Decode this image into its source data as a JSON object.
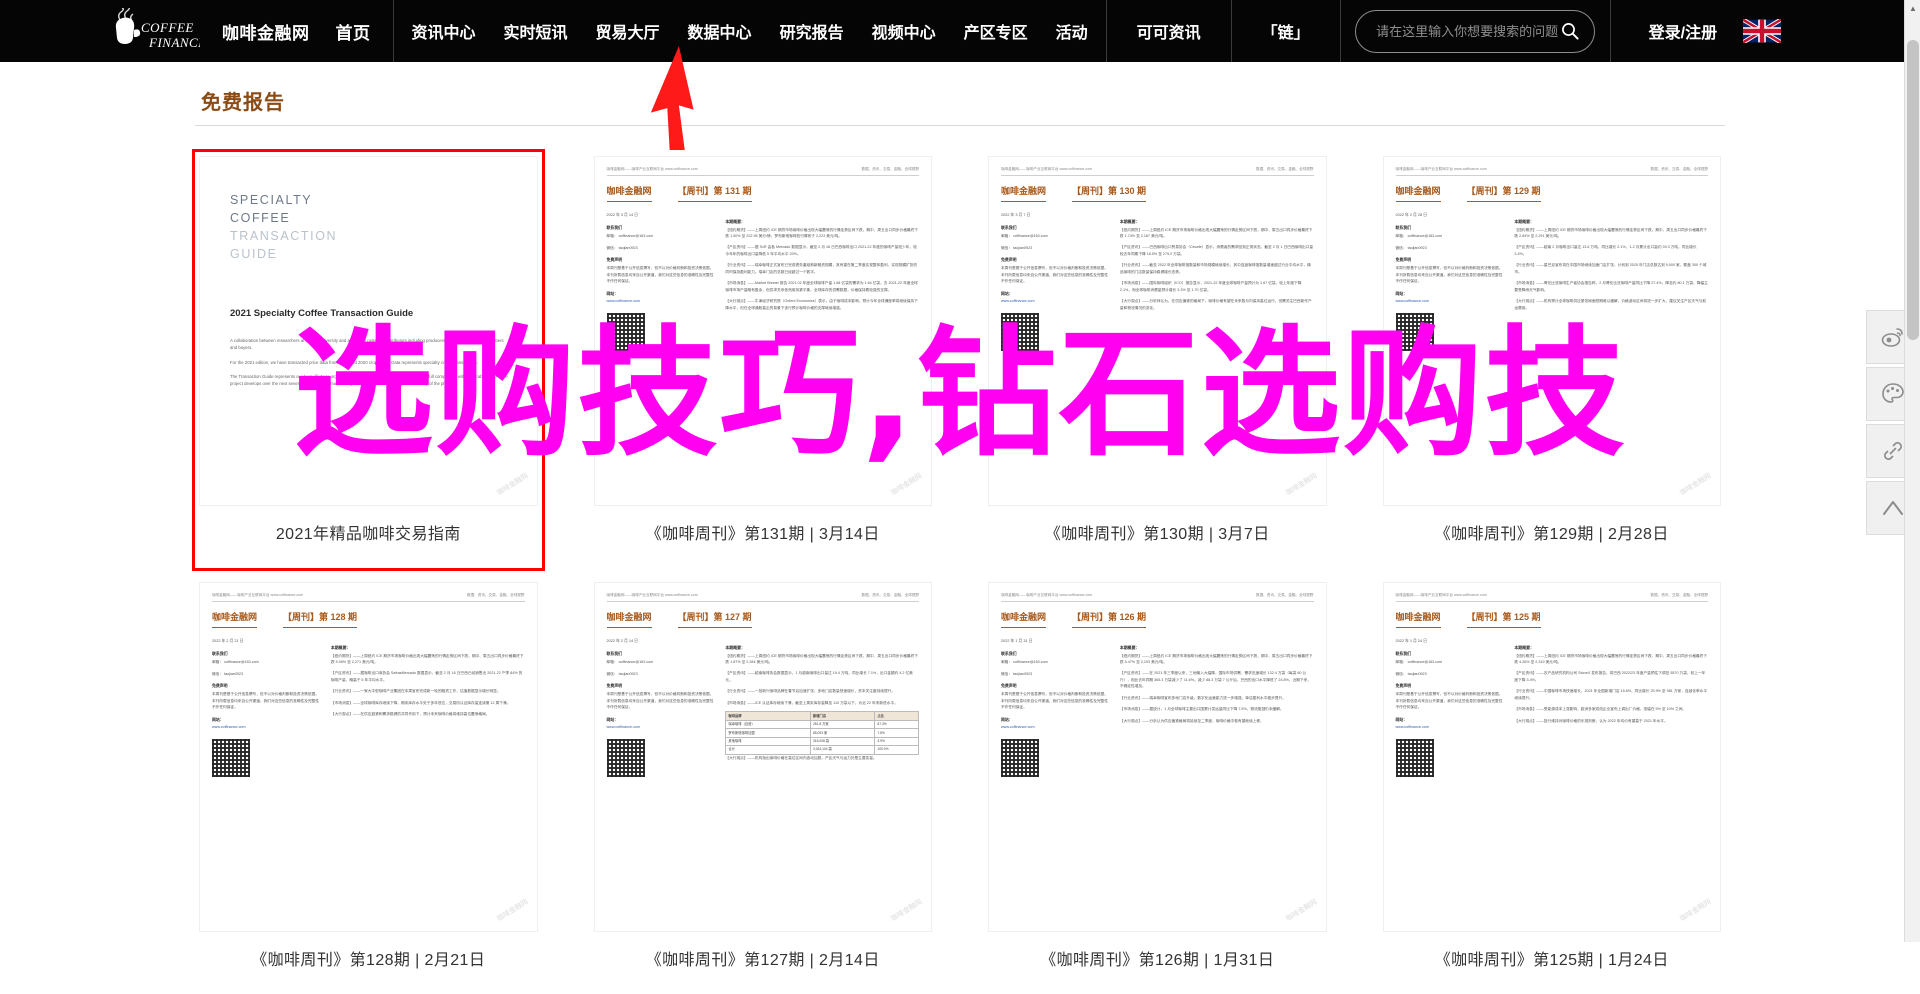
{
  "nav": {
    "logo_line1": "COFFEE",
    "logo_line2": "FINANCE",
    "brand": "咖啡金融网",
    "home": "首页",
    "main_items": [
      {
        "label": "资讯中心"
      },
      {
        "label": "实时短讯"
      },
      {
        "label": "贸易大厅"
      },
      {
        "label": "数据中心"
      },
      {
        "label": "研究报告"
      },
      {
        "label": "视频中心"
      },
      {
        "label": "产区专区"
      },
      {
        "label": "活动"
      }
    ],
    "cell_cocoa": "可可资讯",
    "cell_chain": "「链」",
    "search_placeholder": "请在这里输入你想要搜索的问题",
    "search_value": "",
    "search_icon": "search-icon",
    "login": "登录/注册",
    "flag": "uk-flag-icon"
  },
  "main": {
    "section_title": "免费报告",
    "title_color": "#8a4b14",
    "highlight_color": "#ff0000"
  },
  "cards": [
    {
      "type": "cover",
      "caption": "2021年精品咖啡交易指南",
      "highlighted": true,
      "cover": {
        "line1": "SPECIALTY",
        "line2": "COFFEE",
        "line3": "TRANSACTION",
        "line4": "GUIDE",
        "subtitle": "2021 Specialty Coffee Transaction Guide",
        "p1": "A collaboration between researchers at Emory University and a growing roster of contributors including producers, exporters, importers, roasters and buyers.",
        "p2": "For the 2021 edition, we have transacted price data from 2019 and 2020 crop years. Data represents specialty coffee transactions.",
        "p3": "The Transaction Guide represents our best efforts to organize and analyze the contract data provided in full compliance with applicable law. As the project develops over the next several years, we will make every effort to improve the utility and usability of the platform."
      },
      "watermark": "咖啡金融网"
    },
    {
      "type": "doc",
      "caption": "《咖啡周刊》第131期 | 3月14日",
      "highlighted": false,
      "doc": {
        "head_left": "咖啡金融网——咖啡产业互联网平台 www.coffinance.com",
        "head_right": "数据、资讯、交易、金融、全球视野",
        "brand": "咖啡金融网",
        "issue": "【周刊】第 131 期",
        "date": "2022 年 3 月 14 日",
        "contact_label": "联系我们",
        "contact_mail": "邮箱： coffinance@163.com",
        "contact_wx": "微信： taojian0923",
        "free_label": "免费声明",
        "free_text": "本周刊是基于公开信息撰写，但不以对价格判断和投资决策依据。本刊所载信息均来自公开渠道，我们对这些信息的准确性及完整性不作任何保证。",
        "right_label": "本期概要：",
        "p1": "【纽约期货】——上周纽约 ICE 期货市场咖啡价格出现大幅震荡的行情走势区间下跌，期中、周五出口同步价格最终下跌 1.50% 至 222.95 美分/磅，罗布斯塔咖啡较行情收于 2,223 美元/吨。",
        "p2": "【产区资讯】——据 SvR 由各 Mercado 数据显示，截至 2 月 18 日巴西咖啡出口 2021-22 年度的咖啡产量较少年，较今年年的咖啡出口量降低 5 年平均水平 20%。",
        "p3": "【行业资讯】——瑞幸咖啡正式宣布已完成债务重组和新融资规模，其有望在第二季度实现整体盈利，实现规模扩张的同时保持盈利能力。瑞幸门店的总数已经超过一个数字。",
        "p4": "【市场消息】——Market Brewer 报告 2021 02 年度全球咖啡产量 1.68 亿袋的需求为 1.64 亿袋。去 2021-22 年度全球咖啡市场产量略有盈余，但供求关系依然维持紧平衡，全球库存的供需数据，价格保持着较强的支撑。",
        "p5": "【大行观点】——牛津经济研究院（Oxford Economics）表示，由于咖啡成本影响，预计今年全球通胀率将继续保持下降水平，但在全球通胀高企的背景下该行预计咖啡价格的支撑继续增强。",
        "link_label": "网站：",
        "link": "www.coffinance.com",
        "watermark": "咖啡金融网"
      }
    },
    {
      "type": "doc",
      "caption": "《咖啡周刊》第130期 | 3月7日",
      "highlighted": false,
      "doc": {
        "head_left": "咖啡金融网——咖啡产业互联网平台 www.coffinance.com",
        "head_right": "数据、资讯、交易、金融、全球视野",
        "brand": "咖啡金融网",
        "issue": "【周刊】第 130 期",
        "date": "2022 年 3 月 7 日",
        "contact_label": "联系我们",
        "contact_mail": "邮箱： coffinance@163.com",
        "contact_wx": "微信： taojian0923",
        "free_label": "免费声明",
        "free_text": "本周刊是基于公开信息撰写，但不以对价格判断和投资决策依据。本刊所载信息均来自公开渠道，我们对这些信息的准确性及完整性不作任何保证。",
        "right_label": "本期概要：",
        "p1": "【纽约期货】——上周纽约 ICE 期货市场咖啡价格出现大幅震荡的行情走势区间下跌，期中、周五出口同步价格最终下跌 1.74% 至 2,187 美元/吨。",
        "p2": "【产区资讯】——巴西咖啡出口贸易协会（Cecafe）显示，消费者的需求回到正常状态，截至 2 月 1 日巴西咖啡出口量较去年同期下降 18.5% 至 279.2 万袋。",
        "p3": "【行业资讯】——截至 2022 年全球咖啡馆数量和市场规模继续增长，其中连锁咖啡馆数量增速超过行业平均水平，精品咖啡的门店数量保持稳健增长态势。",
        "p4": "【市场消息】——国际咖啡组织（ICO）报告显示，2021-22 年度全球咖啡产量预计为 1.67 亿袋，较上年度下降 2.1%，而全球咖啡消费量预计增长 3.3% 至 1.70 亿袋。",
        "p5": "【大行观点】——分析师认为，在供应偏紧的格局下，咖啡价格有望在未来数月内保持高位运行，但需关注巴西新作产量和物流情况的变化。",
        "link_label": "网站：",
        "link": "www.coffinance.com",
        "watermark": "咖啡金融网"
      }
    },
    {
      "type": "doc",
      "caption": "《咖啡周刊》第129期 | 2月28日",
      "highlighted": false,
      "doc": {
        "head_left": "咖啡金融网——咖啡产业互联网平台 www.coffinance.com",
        "head_right": "数据、资讯、交易、金融、全球视野",
        "brand": "咖啡金融网",
        "issue": "【周刊】第 129 期",
        "date": "2022 年 2 月 28 日",
        "contact_label": "联系我们",
        "contact_mail": "邮箱： coffinance@163.com",
        "contact_wx": "微信： taojian0923",
        "free_label": "免费声明",
        "free_text": "本周刊是基于公开信息撰写，但不以对价格判断和投资决策依据。本刊所载信息均来自公开渠道，我们对这些信息的准确性及完整性不作任何保证。",
        "right_label": "本期概要：",
        "p1": "【纽约期货】——上周纽约 ICE 期货市场咖啡价格出现大幅震荡的行情走势区间下跌，期中、周五出口同步价格最终下跌 2.84% 至 2,291 美元/吨。",
        "p2": "【产区资讯】——越南 2 月咖啡出口量达 13.6 万吨，同比增长 2.1%，1-2 月累计出口量约 39.3 万吨，同比增长 3.4%。",
        "p3": "【行业资讯】——星巴克宣布将在中国市场继续加速门店扩张，计划到 2025 年门店总数达到 9,000 家，覆盖 300 个城市。",
        "p4": "【市场消息】——哥伦比亚咖啡生产者协会报告称，2 月哥伦比亚咖啡产量同比下降 27.4%，降至约 80.1 万袋，降幅主要受降雨天气影响。",
        "p5": "【大行观点】——机构预计全球咖啡供应紧张局面短期难以缓解，价格波动区间将进一步扩大，建议关注产区天气与航运费用。",
        "link_label": "网站：",
        "link": "www.coffinance.com",
        "watermark": "咖啡金融网"
      }
    },
    {
      "type": "doc",
      "caption": "《咖啡周刊》第128期 | 2月21日",
      "highlighted": false,
      "doc": {
        "head_left": "咖啡金融网——咖啡产业互联网平台 www.coffinance.com",
        "head_right": "数据、资讯、交易、金融、全球视野",
        "brand": "咖啡金融网",
        "issue": "【周刊】第 128 期",
        "date": "2022 年 2 月 21 日",
        "contact_label": "联系我们",
        "contact_mail": "邮箱： coffinance@163.com",
        "contact_wx": "微信： taojian0923",
        "free_label": "免费声明",
        "free_text": "本周刊是基于公开信息撰写，但不以对价格判断和投资决策依据。本刊所载信息均来自公开渠道，我们对这些信息的准确性及完整性不作任何保证。",
        "right_label": "本期概要：",
        "p1": "【纽约期货】——上周纽约 ICE 期货市场咖啡价格出现大幅震荡的行情走势区间下跌，期中、周五出口同步价格最终下跌 5.05% 至 2,271 美元/吨。",
        "p2": "【产区资讯】——据咖啡出口商协会 SafrasMercado 数据显示，截至 2 月 16 日巴西已经销售出 2021-22 产季 84% 的咖啡产量，略高于 5 年平均水平。",
        "p3": "【行业资讯】——一家大中型咖啡产业集团在本周宣布完成新一轮的融资工作，估值数据显示增长明显。",
        "p4": "【市场消息】——全球咖啡库存继续下降，期末库存水平处于多年低位，交易所认证库存量连续第 12 周下滑。",
        "p5": "【大行观点】——在供应趋紧和需求稳健的共同作用下，预计未来咖啡价格将维持高位震荡格局。",
        "link_label": "网站：",
        "link": "www.coffinance.com",
        "watermark": "咖啡金融网"
      }
    },
    {
      "type": "doc",
      "caption": "《咖啡周刊》第127期 | 2月14日",
      "highlighted": false,
      "doc": {
        "head_left": "咖啡金融网——咖啡产业互联网平台 www.coffinance.com",
        "head_right": "数据、资讯、交易、金融、全球视野",
        "brand": "咖啡金融网",
        "issue": "【周刊】第 127 期",
        "date": "2022 年 2 月 14 日",
        "contact_label": "联系我们",
        "contact_mail": "邮箱： coffinance@163.com",
        "contact_wx": "微信： taojian0923",
        "free_label": "免费声明",
        "free_text": "本周刊是基于公开信息撰写，但不以对价格判断和投资决策依据。本刊所载信息均来自公开渠道，我们对这些信息的准确性及完整性不作任何保证。",
        "right_label": "本期概要：",
        "p1": "【纽约期货】——上周纽约 ICE 期货市场咖啡价格出现大幅震荡的行情走势区间下跌，期中、周五出口同步价格最终下跌 1.87% 至 2,284 美元/吨。",
        "p2": "【产区资讯】——越南咖啡协会数据显示，1 月越南咖啡出口量达 19.4 万吨，同比增长 7.1%，出口金额约 4.2 亿美元。",
        "p3": "【行业资讯】——一批新兴咖啡品牌在春节后加速扩张，多地门店数量快速增长，资本关注度持续提升。",
        "p4": "【市场消息】——ICE 认证库存继续下滑，截至上周末库存量降至 110 万袋以下，为近 22 年来新低水平。",
        "p5": "【大行观点】——机构指出咖啡价格在高位区间内波动加剧，产区天气与运力仍是主要变量。",
        "table_headers": [
          "咖啡品牌",
          "新增门店",
          "占比"
        ],
        "table_rows": [
          [
            "瑞幸咖啡（自营）",
            "281.8 万家",
            "87.3%"
          ],
          [
            "罗布斯塔咖啡加盟",
            "85,093 家",
            "7.8%"
          ],
          [
            "其他咖啡",
            "316,008 袋",
            "3.9%"
          ],
          [
            "合计",
            "3,024,104 袋",
            "100.0%"
          ]
        ],
        "link_label": "网站：",
        "link": "www.coffinance.com",
        "watermark": "咖啡金融网"
      }
    },
    {
      "type": "doc",
      "caption": "《咖啡周刊》第126期 | 1月31日",
      "highlighted": false,
      "doc": {
        "head_left": "咖啡金融网——咖啡产业互联网平台 www.coffinance.com",
        "head_right": "数据、资讯、交易、金融、全球视野",
        "brand": "咖啡金融网",
        "issue": "【周刊】第 126 期",
        "date": "2022 年 1 月 31 日",
        "contact_label": "联系我们",
        "contact_mail": "邮箱： coffinance@163.com",
        "contact_wx": "微信： taojian0923",
        "free_label": "免费声明",
        "free_text": "本周刊是基于公开信息撰写，但不以对价格判断和投资决策依据。本刊所载信息均来自公开渠道，我们对这些信息的准确性及完整性不作任何保证。",
        "right_label": "本期概要：",
        "p1": "【纽约期货】——上周纽约 ICE 期货市场咖啡价格出现大幅震荡的行情走势区间下跌，期中、周五出口同步价格最终下跌 5.47% 至 2,193 美元/吨。",
        "p2": "【产区资讯】——在 2021 年三季度以来，三地输入大幅降，国际市场供需、需求迅速增长 132.4 万袋（每袋 60 公斤），相比去年同期 365.3 万袋减少了 11.6%。减少 88.3 万袋 7 公斤后，巴西的出口水平降低了 24.8%，近期下来，不确定性增加。",
        "p3": "【行业资讯】——瑞幸咖啡宣布多地门店升级，数字化运营能力进一步增强，单店盈利水平稳步提升。",
        "p4": "【市场消息】——据统计，1 月全球咖啡主要出口国累计发运量同比下降 7.5%，物流瓶颈仍未缓解。",
        "p5": "【大行观点】——分析认为供应偏紧格局将延续至二季度，咖啡价格中枢有望继续上移。",
        "link_label": "网站：",
        "link": "www.coffinance.com",
        "watermark": "咖啡金融网"
      }
    },
    {
      "type": "doc",
      "caption": "《咖啡周刊》第125期 | 1月24日",
      "highlighted": false,
      "doc": {
        "head_left": "咖啡金融网——咖啡产业互联网平台 www.coffinance.com",
        "head_right": "数据、资讯、交易、金融、全球视野",
        "brand": "咖啡金融网",
        "issue": "【周刊】第 125 期",
        "date": "2022 年 1 月 24 日",
        "contact_label": "联系我们",
        "contact_mail": "邮箱： coffinance@163.com",
        "contact_wx": "微信： taojian0923",
        "free_label": "免费声明",
        "free_text": "本周刊是基于公开信息撰写，但不以对价格判断和投资决策依据。本刊所载信息均来自公开渠道，我们对这些信息的准确性及完整性不作任何保证。",
        "right_label": "本期概要：",
        "p1": "【纽约期货】——上周纽约 ICE 期货市场咖啡价格出现大幅震荡的行情走势区间下跌，期中、周五出口同步价格最终下跌 4.26% 至 2,319 美元/吨。",
        "p2": "【产区资讯】——农产品研究机构公司 StoneX 发布报告，将巴西 2022/23 年度产量预估下调至 5570 万袋，较上一年度下降 3.4%。",
        "p3": "【行业资讯】——中国咖啡市场快速增长，2021 年全国新增门店 15.8%，同比增长 25.9% 至 981 万家，连锁化率水平继续提升。",
        "p4": "【市场消息】——受能源成本上涨影响，欧洲多家烘焙企业宣布上调出厂价格，涨幅在 5% 至 10% 之间。",
        "p5": "【大行观点】——投行维持对咖啡价格的乐观判断，认为 2022 年均价有望高于 2021 年水平。",
        "link_label": "网站：",
        "link": "www.coffinance.com",
        "watermark": "咖啡金融网"
      }
    }
  ],
  "floatbar": [
    {
      "icon": "weibo-icon",
      "name": "weibo"
    },
    {
      "icon": "palette-icon",
      "name": "palette"
    },
    {
      "icon": "link-icon",
      "name": "link"
    },
    {
      "icon": "back-to-top-icon",
      "name": "back-to-top"
    }
  ],
  "overlay": {
    "text": "选购技巧,钻石选购技",
    "color": "#ff00f0"
  },
  "annotation": {
    "arrow_color": "#ff1a1a",
    "points_at": "研究报告"
  },
  "scrollbar": {
    "up": "▲",
    "down": "▼"
  }
}
